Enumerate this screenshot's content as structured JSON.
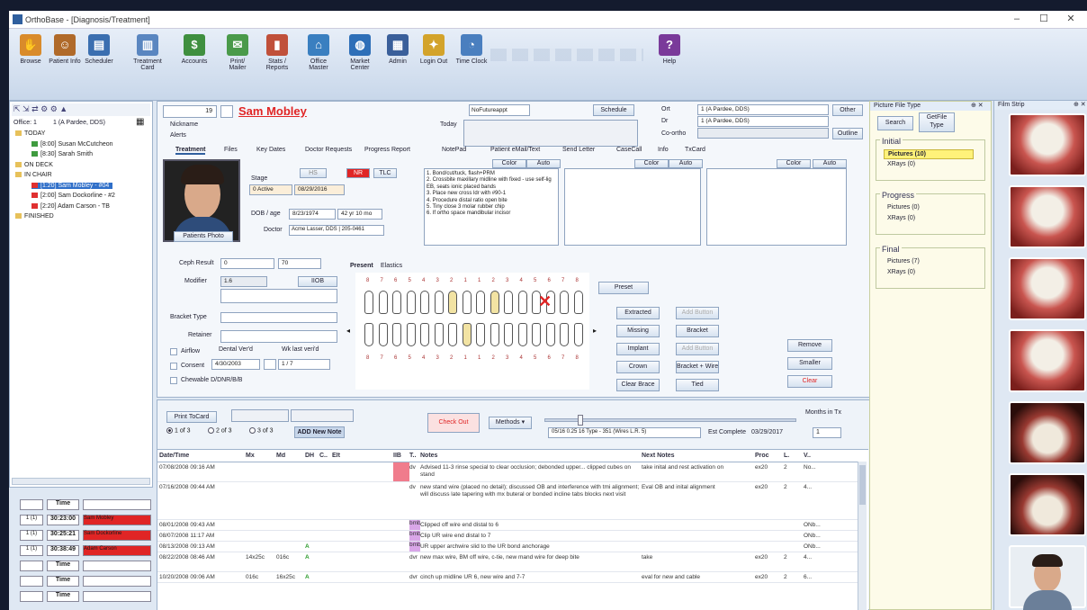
{
  "window": {
    "title": "OrthoBase - [Diagnosis/Treatment]",
    "min": "–",
    "max": "☐",
    "close": "✕"
  },
  "ribbon": {
    "buttons": [
      {
        "label": "Browse",
        "icon": "hand-icon",
        "color": "#d98b2b"
      },
      {
        "label": "Patient Info",
        "icon": "patient-icon",
        "color": "#b06a2a"
      },
      {
        "label": "Scheduler",
        "icon": "scheduler-icon",
        "color": "#3b6fb0"
      },
      {
        "label": "Treatment Card",
        "icon": "card-icon",
        "color": "#5a86c0"
      },
      {
        "label": "Accounts",
        "icon": "accounts-icon",
        "color": "#3f8f3f"
      },
      {
        "label": "Print/ Mailer",
        "icon": "print-icon",
        "color": "#4a9a4a"
      },
      {
        "label": "Stats / Reports",
        "icon": "reports-icon",
        "color": "#c0503a"
      },
      {
        "label": "Office Master",
        "icon": "office-icon",
        "color": "#3a7fc0"
      },
      {
        "label": "Market Center",
        "icon": "globe-icon",
        "color": "#2e6fb8"
      },
      {
        "label": "Admin",
        "icon": "admin-icon",
        "color": "#3a5f9a"
      },
      {
        "label": "Login Out",
        "icon": "lock-icon",
        "color": "#d3a32b"
      },
      {
        "label": "Time Clock",
        "icon": "clock-icon",
        "color": "#4a7fbf"
      },
      {
        "label": "Help",
        "icon": "help-icon",
        "color": "#7a3a9a"
      }
    ]
  },
  "left": {
    "office_label": "Office: 1",
    "office_value": "1 (A Pardee, DDS)",
    "tree": [
      {
        "label": "TODAY",
        "indent": 0,
        "type": "folder"
      },
      {
        "label": "[8:00] Susan McCutcheon",
        "indent": 1,
        "type": "green"
      },
      {
        "label": "[8:30] Sarah Smith",
        "indent": 1,
        "type": "green"
      },
      {
        "label": "ON DECK",
        "indent": 0,
        "type": "folder"
      },
      {
        "label": "IN CHAIR",
        "indent": 0,
        "type": "folder"
      },
      {
        "label": "[1:20] Sam Mobley - #04",
        "indent": 1,
        "type": "red",
        "selected": true
      },
      {
        "label": "[2:00] Sam Dockorline - #2",
        "indent": 1,
        "type": "red"
      },
      {
        "label": "[2:20] Adam Carson - TB",
        "indent": 1,
        "type": "red"
      },
      {
        "label": "FINISHED",
        "indent": 0,
        "type": "folder"
      }
    ],
    "timers": [
      {
        "chair": "",
        "time": "Time",
        "name": "",
        "red": false
      },
      {
        "chair": "1 (1)",
        "time": "30:23:00",
        "name": "Sam Mobley",
        "red": true
      },
      {
        "chair": "1 (1)",
        "time": "30:25:21",
        "name": "Sam Dockorline",
        "red": true
      },
      {
        "chair": "1 (1)",
        "time": "30:38:49",
        "name": "Adam Carson",
        "red": true
      },
      {
        "chair": "",
        "time": "Time",
        "name": "",
        "red": false
      },
      {
        "chair": "",
        "time": "Time",
        "name": "",
        "red": false
      },
      {
        "chair": "",
        "time": "Time",
        "name": "",
        "red": false
      }
    ]
  },
  "patient": {
    "id": "19",
    "name": "Sam Mobley",
    "nickname_label": "Nickname",
    "alert_label": "Alerts",
    "today_label": "Today",
    "schedule_btn": "Schedule",
    "next_appt": "NoFutureappt",
    "ortho_label": "Ort",
    "dr_label": "Dr",
    "ortho_value": "1 (A Pardee, DDS)",
    "dr_value": "1 (A Pardee, DDS)",
    "other_btn": "Other",
    "coord_label": "Co-ortho",
    "outline_btn": "Outline",
    "tabs": [
      "Treatment",
      "Files",
      "Key Dates",
      "Doctor Requests",
      "Progress Report",
      "NotePad",
      "Patient eMail/Text",
      "Send Letter",
      "CaseCall",
      "Info",
      "TxCard"
    ],
    "photo_label": "Patients Photo",
    "stage_label": "Stage",
    "stage_value": "0 Active",
    "stage_date": "08/29/2016",
    "dob_label": "DOB / age",
    "dob_value": "8/23/1974",
    "age_value": "42 yr 10 mo",
    "doctor_label": "Doctor",
    "doctor_value": "Acme Lasser, DDS | 205-0461",
    "badges": [
      "HS",
      "NR",
      "TLC"
    ],
    "color_btn": "Color",
    "auto_btn": "Auto",
    "notes": "1. Bond/cut/tuck, flash+PRM\n2. Crossbite maxillary midline with fixed - use self-lig EB, seats ionic placed bands\n3. Place new cross ldr with #90-1\n4. Procedure distal ratio open bite\n5. Tiny close 3 molar rubber chip\n6. If ortho space mandibular incisor",
    "ceph_label": "Ceph Result",
    "ceph_value": "0",
    "ceph_value2": "70",
    "modifier_label": "Modifier",
    "modifier_value": "1.6",
    "modifier_btn": "IIOB",
    "bracket_label": "Bracket Type",
    "retainer_label": "Retainer",
    "airflow_label": "Airflow",
    "consent_label": "Consent",
    "consent_value": "4/30/2003",
    "dental_label": "Dental Ver'd",
    "wks_label": "Wk last veri'd",
    "wks_value": "1 / 7",
    "chewable_label": "Chewable D/DNR/B/B",
    "chart_tabs": [
      "Present",
      "Elastics"
    ],
    "upper_nums": [
      "8",
      "7",
      "6",
      "5",
      "4",
      "3",
      "2",
      "1",
      "1",
      "2",
      "3",
      "4",
      "5",
      "6",
      "7",
      "8"
    ],
    "lower_nums": [
      "8",
      "7",
      "6",
      "5",
      "4",
      "3",
      "2",
      "1",
      "1",
      "2",
      "3",
      "4",
      "5",
      "6",
      "7",
      "8"
    ],
    "preset_btn": "Preset",
    "tooth_buttons": [
      "Extracted",
      "Missing",
      "Implant",
      "Crown",
      "Clear Brace"
    ],
    "tooth_buttons2": [
      "Bracket",
      "Bracket + Wire",
      "Tied"
    ],
    "tooth_disabled": [
      "Add Button",
      "Add Button"
    ],
    "right_buttons": [
      "Remove",
      "Smaller",
      "Clear"
    ]
  },
  "log": {
    "print_btn": "Print ToCard",
    "radios": [
      "1 of 3",
      "2 of 3",
      "3 of 3"
    ],
    "add_btn": "ADD New Note",
    "check_btn": "Check Out",
    "methods_btn": "Methods",
    "slider_value": "0.25",
    "wire_value": "05/16 0.25 16 Type - 351 (Wires L.R. 5)",
    "est_label": "Est Complete",
    "est_value": "03/29/2017",
    "months_label": "Months in Tx",
    "months_value": "1",
    "headers": [
      "Date/Time",
      "Mx",
      "Md",
      "DH",
      "C..",
      "Elt",
      "IIB",
      "T..",
      "Notes",
      "Next Notes",
      "Proc",
      "L.",
      "V.."
    ],
    "rows": [
      {
        "date": "07/08/2008 09:16 AM",
        "mx": "",
        "md": "",
        "dh": "",
        "c": "",
        "elt": "",
        "iib": "pink",
        "t": "dv",
        "notes": "Advised 11-3 rinse special to clear occlusion; debonded upper... clipped cubes on stand",
        "next": "take inital and rest activation on",
        "proc": "ex20",
        "l": "2",
        "v": "No..."
      },
      {
        "date": "07/16/2008 09:44 AM",
        "mx": "",
        "md": "",
        "dh": "",
        "c": "",
        "elt": "",
        "iib": "",
        "t": "dv",
        "notes": "new stand wire (placed no detail); discussed OB and interference with tmi alignment; will discuss late tapering with mx buteral or bonded incline tabs blocks next visit",
        "next": "Eval OB and inital alignment",
        "proc": "ex20",
        "l": "2",
        "v": "4..."
      },
      {
        "date": "08/01/2008 09:43 AM",
        "mx": "",
        "md": "",
        "dh": "",
        "c": "",
        "elt": "",
        "iib": "",
        "t": "bmb",
        "notes": "Clipped off wire end distal to 6",
        "next": "",
        "proc": "",
        "l": "",
        "v": "ONb..."
      },
      {
        "date": "08/07/2008 11:17 AM",
        "mx": "",
        "md": "",
        "dh": "",
        "c": "",
        "elt": "",
        "iib": "",
        "t": "bmb",
        "notes": "Clip UR wire end distal to 7",
        "next": "",
        "proc": "",
        "l": "",
        "v": "ONb..."
      },
      {
        "date": "08/13/2008 09:13 AM",
        "mx": "",
        "md": "",
        "dh": "A",
        "c": "",
        "elt": "",
        "iib": "",
        "t": "bmb",
        "notes": "UR upper archwire slid to the UR bond anchorage",
        "next": "",
        "proc": "",
        "l": "",
        "v": "ONb..."
      },
      {
        "date": "08/22/2008 08:46 AM",
        "mx": "14x25c",
        "md": "016c",
        "dh": "A",
        "c": "",
        "elt": "",
        "iib": "",
        "t": "dvr",
        "notes": "new max wire, BM off wire, c-tie, new mand wire for deep bite",
        "next": "take",
        "proc": "ex20",
        "l": "2",
        "v": "4..."
      },
      {
        "date": "10/20/2008 09:06 AM",
        "mx": "016c",
        "md": "16x25c",
        "dh": "A",
        "c": "",
        "elt": "",
        "iib": "",
        "t": "dvr",
        "notes": "cinch up midline UR 6, new wire and 7-7",
        "next": "eval for new and cable",
        "proc": "ex20",
        "l": "2",
        "v": "6..."
      }
    ]
  },
  "picture_files": {
    "title": "Picture File Type",
    "search_btn": "Search",
    "gettype_btn": "GetFile Type",
    "groups": [
      {
        "name": "Initial",
        "items": [
          "Pictures (10)",
          "XRays (0)"
        ],
        "highlight": 0
      },
      {
        "name": "Progress",
        "items": [
          "Pictures (0)",
          "XRays (0)"
        ],
        "highlight": -1
      },
      {
        "name": "Final",
        "items": [
          "Pictures (7)",
          "XRays (0)"
        ],
        "highlight": -1
      }
    ]
  },
  "film_strip": {
    "title": "Film Strip"
  },
  "colors": {
    "accent": "#2f5f9e",
    "red": "#e03030",
    "pink": "#f07c8c",
    "highlight": "#fff27a",
    "lavender": "#d9a6e8"
  }
}
